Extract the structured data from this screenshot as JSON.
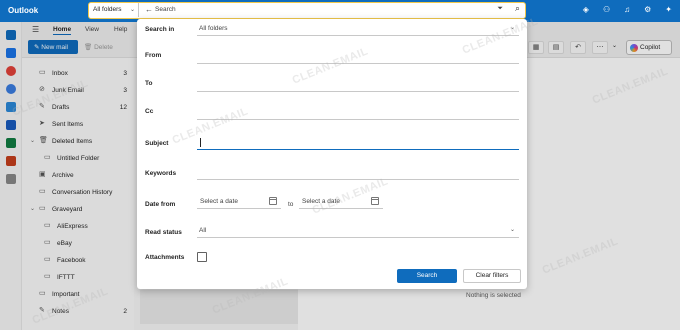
{
  "app": {
    "title": "Outlook"
  },
  "search": {
    "scope": "All folders",
    "placeholder": "Search"
  },
  "tabs": [
    "Home",
    "View",
    "Help"
  ],
  "ribbon": {
    "new_mail": "New mail",
    "delete": "Delete",
    "copilot": "Copilot"
  },
  "folders": [
    {
      "label": "Inbox",
      "count": "3",
      "icon": "inbox-icon"
    },
    {
      "label": "Junk Email",
      "count": "3",
      "icon": "junk-icon"
    },
    {
      "label": "Drafts",
      "count": "12",
      "icon": "pencil-icon"
    },
    {
      "label": "Sent Items",
      "count": "",
      "icon": "send-icon"
    },
    {
      "label": "Deleted Items",
      "count": "",
      "icon": "trash-icon"
    },
    {
      "label": "Untitled Folder",
      "count": "",
      "icon": "folder-icon"
    },
    {
      "label": "Archive",
      "count": "",
      "icon": "archive-icon"
    },
    {
      "label": "Conversation History",
      "count": "",
      "icon": "folder-icon"
    },
    {
      "label": "Graveyard",
      "count": "",
      "icon": "folder-icon"
    },
    {
      "label": "AliExpress",
      "count": "",
      "icon": "folder-icon"
    },
    {
      "label": "eBay",
      "count": "",
      "icon": "folder-icon"
    },
    {
      "label": "Facebook",
      "count": "",
      "icon": "folder-icon"
    },
    {
      "label": "IFTTT",
      "count": "",
      "icon": "folder-icon"
    },
    {
      "label": "Important",
      "count": "",
      "icon": "folder-icon"
    },
    {
      "label": "Notes",
      "count": "2",
      "icon": "notes-icon"
    }
  ],
  "panel": {
    "search_in_label": "Search in",
    "search_in_value": "All folders",
    "from_label": "From",
    "to_label": "To",
    "cc_label": "Cc",
    "subject_label": "Subject",
    "keywords_label": "Keywords",
    "date_from_label": "Date from",
    "date_placeholder": "Select a date",
    "date_to": "to",
    "read_status_label": "Read status",
    "read_status_value": "All",
    "attachments_label": "Attachments",
    "search_button": "Search",
    "clear_button": "Clear filters"
  },
  "reading_pane": {
    "empty_text": "Nothing is selected"
  },
  "watermark": "CLEAN.EMAIL",
  "colors": {
    "accent": "#0f6cbd",
    "focus_border": "#f2c94c"
  }
}
